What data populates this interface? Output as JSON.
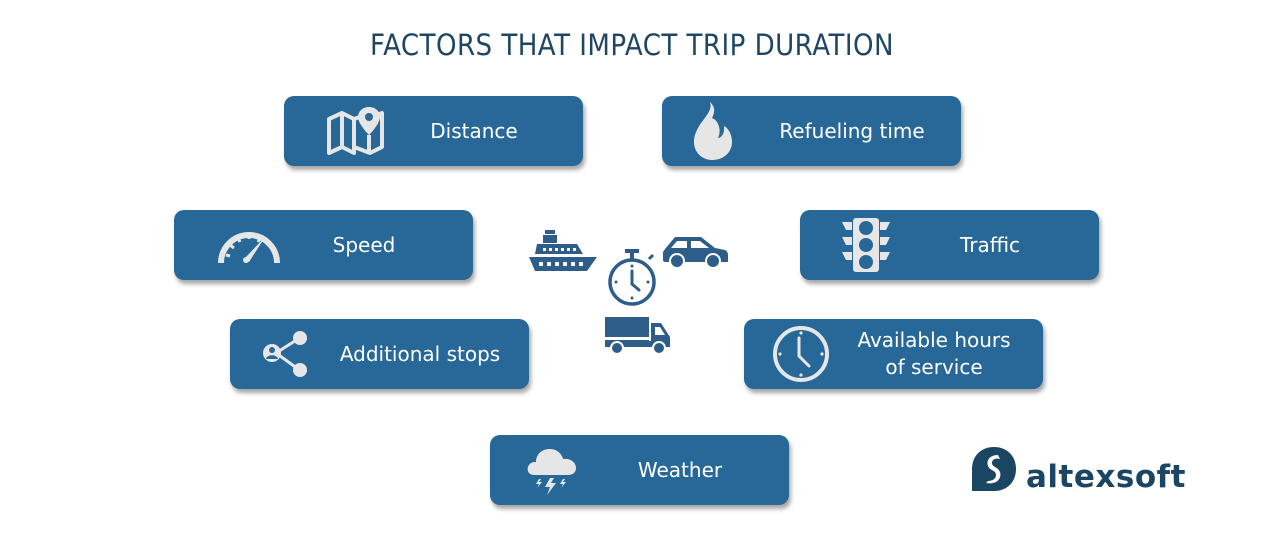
{
  "title": "FACTORS THAT IMPACT TRIP DURATION",
  "colors": {
    "card_background": "#276899",
    "title_text": "#1f4763",
    "icon_light": "#e6e6e6",
    "center_icons": "#2f5d8a",
    "logo": "#1b4663"
  },
  "factors": [
    {
      "label": "Distance",
      "icon": "map-pin-icon"
    },
    {
      "label": "Refueling time",
      "icon": "flame-icon"
    },
    {
      "label": "Speed",
      "icon": "speedometer-icon"
    },
    {
      "label": "Traffic",
      "icon": "traffic-light-icon"
    },
    {
      "label": "Additional stops",
      "icon": "share-nodes-icon"
    },
    {
      "label": "Available hours of service",
      "label_lines": [
        "Available hours",
        "of service"
      ],
      "icon": "clock-icon"
    },
    {
      "label": "Weather",
      "icon": "storm-cloud-icon"
    }
  ],
  "center_icons": [
    "ship-icon",
    "car-icon",
    "stopwatch-icon",
    "truck-icon"
  ],
  "logo": {
    "text": "altexsoft",
    "icon": "altexsoft-logo-icon"
  }
}
